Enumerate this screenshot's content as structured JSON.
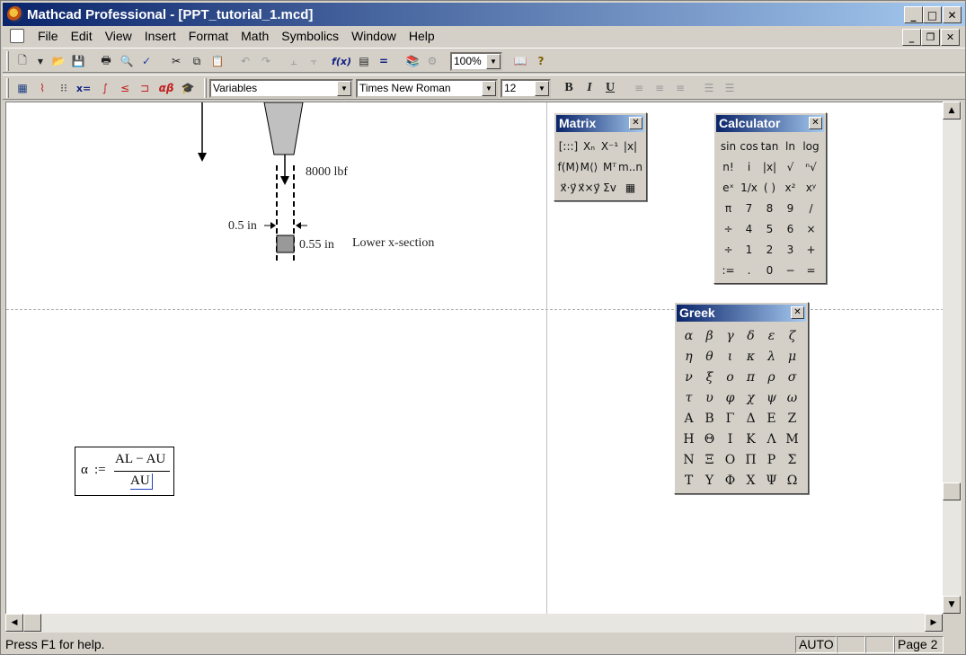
{
  "window": {
    "title": "Mathcad Professional - [PPT_tutorial_1.mcd]",
    "minimize": "_",
    "maximize": "□",
    "close": "✕",
    "restore": "❐"
  },
  "menu": {
    "items": [
      "File",
      "Edit",
      "View",
      "Insert",
      "Format",
      "Math",
      "Symbolics",
      "Window",
      "Help"
    ]
  },
  "toolbar": {
    "zoom": "100%",
    "style": "Variables",
    "font": "Times New Roman",
    "size": "12",
    "bold": "B",
    "italic": "I",
    "underline": "U",
    "fx": "f(x)",
    "xeq": "x=",
    "alpha_beta": "αβ"
  },
  "drawing": {
    "load_label": "8000 lbf",
    "width_label": "0.5 in",
    "depth_label": "0.55 in",
    "section_label": "Lower x-section"
  },
  "math": {
    "lhs": "α",
    "assign": ":=",
    "numerator": "AL − AU",
    "denominator": "AU"
  },
  "palettes": {
    "matrix": {
      "title": "Matrix",
      "cells": [
        "[:::]",
        "Xₙ",
        "X⁻¹",
        "|x|",
        "f(M)",
        "M⟨⟩",
        "Mᵀ",
        "m..n",
        "x⃗·y⃗",
        "x⃗×y⃗",
        "Σv",
        "▦"
      ]
    },
    "calculator": {
      "title": "Calculator",
      "cells": [
        "sin",
        "cos",
        "tan",
        "ln",
        "log",
        "n!",
        "i",
        "|x|",
        "√",
        "ⁿ√",
        "eˣ",
        "1/x",
        "( )",
        "x²",
        "xʸ",
        "π",
        "7",
        "8",
        "9",
        "/",
        "÷",
        "4",
        "5",
        "6",
        "×",
        "÷",
        "1",
        "2",
        "3",
        "+",
        ":=",
        ".",
        "0",
        "−",
        "="
      ]
    },
    "greek": {
      "title": "Greek",
      "lower": [
        "α",
        "β",
        "γ",
        "δ",
        "ε",
        "ζ",
        "η",
        "θ",
        "ι",
        "κ",
        "λ",
        "μ",
        "ν",
        "ξ",
        "ο",
        "π",
        "ρ",
        "σ",
        "τ",
        "υ",
        "φ",
        "χ",
        "ψ",
        "ω"
      ],
      "upper": [
        "Α",
        "Β",
        "Γ",
        "Δ",
        "Ε",
        "Ζ",
        "Η",
        "Θ",
        "Ι",
        "Κ",
        "Λ",
        "Μ",
        "Ν",
        "Ξ",
        "Ο",
        "Π",
        "Ρ",
        "Σ",
        "Τ",
        "Υ",
        "Φ",
        "Χ",
        "Ψ",
        "Ω"
      ]
    }
  },
  "status": {
    "message": "Press F1 for help.",
    "mode": "AUTO",
    "page": "Page 2"
  }
}
